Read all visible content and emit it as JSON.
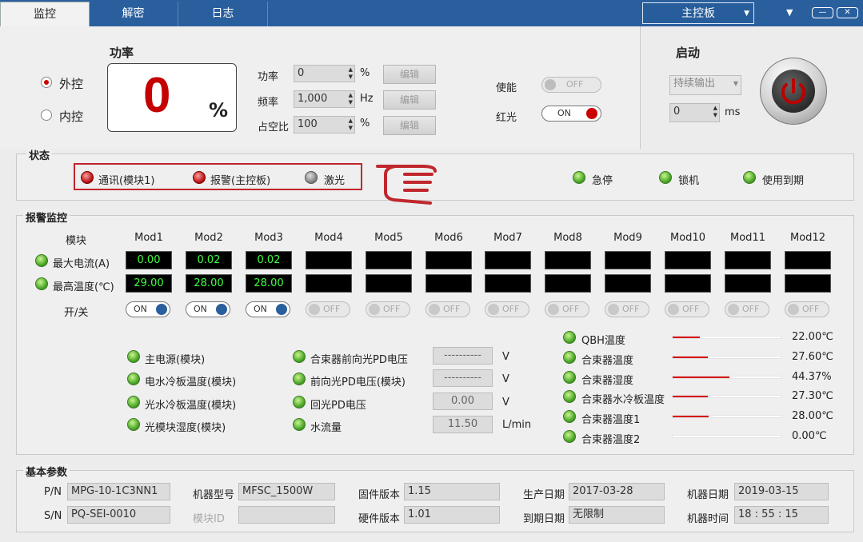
{
  "tabs": [
    {
      "label": "监控"
    },
    {
      "label": "解密"
    },
    {
      "label": "日志"
    }
  ],
  "board_select": {
    "value": "主控板"
  },
  "window_controls": {
    "min": "—",
    "close": "✕",
    "dropdown": "▼"
  },
  "control": {
    "radio_external": "外控",
    "radio_internal": "内控",
    "selected": "外控",
    "power_title": "功率",
    "power_value": "0",
    "power_unit": "%",
    "params": [
      {
        "label": "功率",
        "value": "0",
        "unit": "%",
        "edit": "编辑"
      },
      {
        "label": "频率",
        "value": "1,000",
        "unit": "Hz",
        "edit": "编辑"
      },
      {
        "label": "占空比",
        "value": "100",
        "unit": "%",
        "edit": "编辑"
      }
    ],
    "enable_label": "使能",
    "enable_state": "OFF",
    "redlight_label": "红光",
    "redlight_state": "ON"
  },
  "start": {
    "title": "启动",
    "mode": "持续输出",
    "ms_value": "0",
    "ms_unit": "ms"
  },
  "status": {
    "title": "状态",
    "items": [
      {
        "label": "通讯(模块1)",
        "led": "red"
      },
      {
        "label": "报警(主控板)",
        "led": "red"
      },
      {
        "label": "激光",
        "led": "grey"
      }
    ],
    "right_items": [
      {
        "label": "急停",
        "led": "green"
      },
      {
        "label": "锁机",
        "led": "green"
      },
      {
        "label": "使用到期",
        "led": "green"
      }
    ]
  },
  "alarm": {
    "title": "报警监控",
    "module_header": "模块",
    "row_current": "最大电流(A)",
    "row_temp": "最高温度(℃)",
    "row_switch": "开/关",
    "modules": [
      {
        "name": "Mod1",
        "current": "0.00",
        "temp": "29.00",
        "switch": "ON"
      },
      {
        "name": "Mod2",
        "current": "0.02",
        "temp": "28.00",
        "switch": "ON"
      },
      {
        "name": "Mod3",
        "current": "0.02",
        "temp": "28.00",
        "switch": "ON"
      },
      {
        "name": "Mod4",
        "current": "",
        "temp": "",
        "switch": "OFF"
      },
      {
        "name": "Mod5",
        "current": "",
        "temp": "",
        "switch": "OFF"
      },
      {
        "name": "Mod6",
        "current": "",
        "temp": "",
        "switch": "OFF"
      },
      {
        "name": "Mod7",
        "current": "",
        "temp": "",
        "switch": "OFF"
      },
      {
        "name": "Mod8",
        "current": "",
        "temp": "",
        "switch": "OFF"
      },
      {
        "name": "Mod9",
        "current": "",
        "temp": "",
        "switch": "OFF"
      },
      {
        "name": "Mod10",
        "current": "",
        "temp": "",
        "switch": "OFF"
      },
      {
        "name": "Mod11",
        "current": "",
        "temp": "",
        "switch": "OFF"
      },
      {
        "name": "Mod12",
        "current": "",
        "temp": "",
        "switch": "OFF"
      }
    ],
    "left_status": [
      "主电源(模块)",
      "电水冷板温度(模块)",
      "光水冷板温度(模块)",
      "光模块湿度(模块)"
    ],
    "mid_status": [
      {
        "label": "合束器前向光PD电压",
        "value": "----------",
        "unit": "V"
      },
      {
        "label": "前向光PD电压(模块)",
        "value": "----------",
        "unit": "V"
      },
      {
        "label": "回光PD电压",
        "value": "0.00",
        "unit": "V"
      },
      {
        "label": "水流量",
        "value": "11.50",
        "unit": "L/min"
      }
    ],
    "bars": [
      {
        "label": "QBH温度",
        "value": "22.00℃",
        "fill": 0.25
      },
      {
        "label": "合束器温度",
        "value": "27.60℃",
        "fill": 0.32
      },
      {
        "label": "合束器湿度",
        "value": "44.37%",
        "fill": 0.52
      },
      {
        "label": "合束器水冷板温度",
        "value": "27.30℃",
        "fill": 0.32
      },
      {
        "label": "合束器温度1",
        "value": "28.00℃",
        "fill": 0.33
      },
      {
        "label": "合束器温度2",
        "value": "0.00℃",
        "fill": 0
      }
    ]
  },
  "basic": {
    "title": "基本参数",
    "pn_label": "P/N",
    "pn": "MPG-10-1C3NN1",
    "sn_label": "S/N",
    "sn": "PQ-SEI-0010",
    "model_label": "机器型号",
    "model": "MFSC_1500W",
    "module_id_label": "模块ID",
    "module_id": "",
    "fw_label": "固件版本",
    "fw": "1.15",
    "hw_label": "硬件版本",
    "hw": "1.01",
    "prod_date_label": "生产日期",
    "prod_date": "2017-03-28",
    "exp_date_label": "到期日期",
    "exp_date": "无限制",
    "mach_date_label": "机器日期",
    "mach_date": "2019-03-15",
    "mach_time_label": "机器时间",
    "mach_time": "18 : 55 : 15"
  }
}
